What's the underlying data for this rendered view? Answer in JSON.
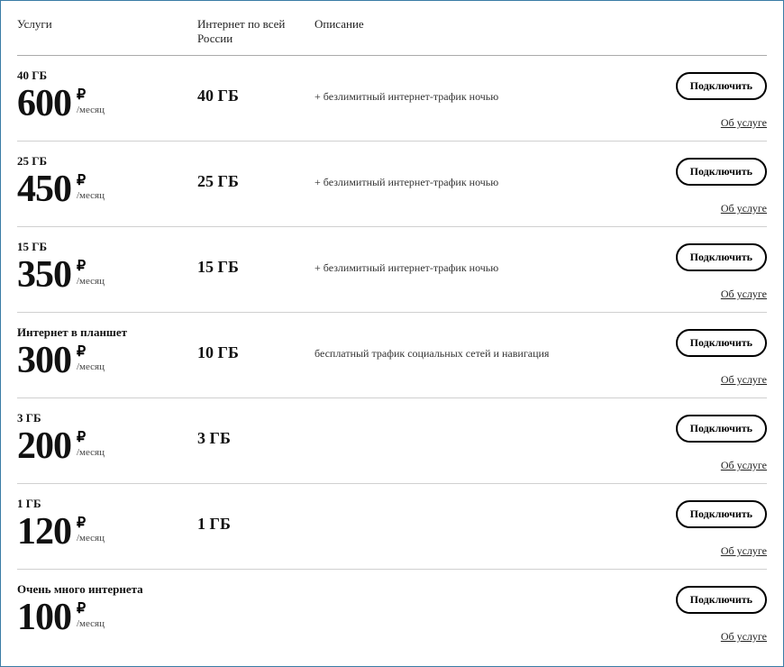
{
  "headers": {
    "service": "Услуги",
    "data": "Интернет по всей России",
    "desc": "Описание"
  },
  "labels": {
    "connect": "Подключить",
    "about": "Об услуге",
    "per_month": "/месяц",
    "ruble": "₽"
  },
  "plans": [
    {
      "title": "40 ГБ",
      "price": "600",
      "data": "40 ГБ",
      "desc": "+ безлимитный интернет-трафик ночью"
    },
    {
      "title": "25 ГБ",
      "price": "450",
      "data": "25 ГБ",
      "desc": "+ безлимитный интернет-трафик ночью"
    },
    {
      "title": "15 ГБ",
      "price": "350",
      "data": "15 ГБ",
      "desc": "+ безлимитный интернет-трафик ночью"
    },
    {
      "title": "Интернет в планшет",
      "price": "300",
      "data": "10 ГБ",
      "desc": "бесплатный трафик социальных сетей и навигация"
    },
    {
      "title": "3 ГБ",
      "price": "200",
      "data": "3 ГБ",
      "desc": ""
    },
    {
      "title": "1 ГБ",
      "price": "120",
      "data": "1 ГБ",
      "desc": ""
    },
    {
      "title": "Очень много интернета",
      "price": "100",
      "data": "",
      "desc": ""
    }
  ]
}
